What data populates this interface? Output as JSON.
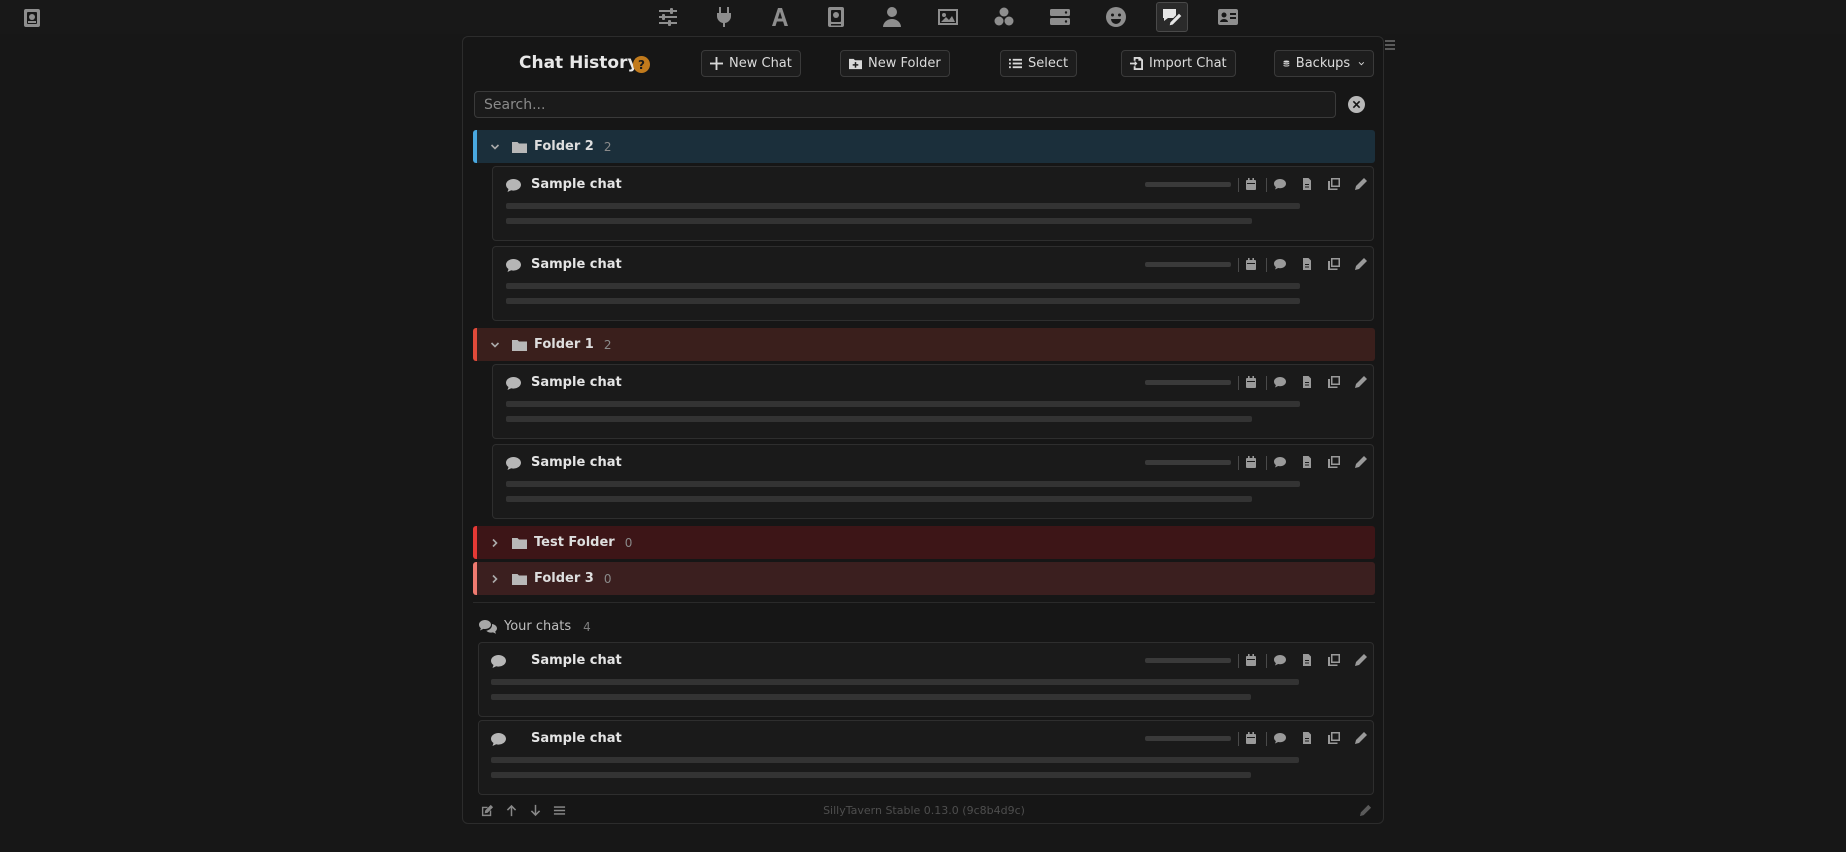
{
  "topbar": {
    "left_icon": "book-icon",
    "icons": [
      {
        "name": "sliders-icon",
        "active": false
      },
      {
        "name": "plug-icon",
        "active": false
      },
      {
        "name": "font-icon",
        "active": false
      },
      {
        "name": "book-atlas-icon",
        "active": false
      },
      {
        "name": "user-icon",
        "active": false
      },
      {
        "name": "image-icon",
        "active": false
      },
      {
        "name": "cubes-icon",
        "active": false
      },
      {
        "name": "server-icon",
        "active": false
      },
      {
        "name": "smile-icon",
        "active": false
      },
      {
        "name": "pen-chat-icon",
        "active": true
      },
      {
        "name": "id-card-icon",
        "active": false
      }
    ]
  },
  "header": {
    "title": "Chat History",
    "help_label": "?",
    "new_chat_label": "New Chat",
    "new_folder_label": "New Folder",
    "select_label": "Select",
    "import_label": "Import Chat",
    "backups_label": "Backups"
  },
  "search": {
    "placeholder": "Search..."
  },
  "folders": [
    {
      "name": "Folder 2",
      "count": "2",
      "expanded": true,
      "color": "#49a8e0",
      "bg": "#1b2f3b"
    },
    {
      "name": "Folder 1",
      "count": "2",
      "expanded": true,
      "color": "#e04a3a",
      "bg": "#3a1f1c"
    },
    {
      "name": "Test Folder",
      "count": "0",
      "expanded": false,
      "color": "#e53935",
      "bg": "#3d1517"
    },
    {
      "name": "Folder 3",
      "count": "0",
      "expanded": false,
      "color": "#ef7a70",
      "bg": "#3b1f1f"
    }
  ],
  "folder_chats": [
    {
      "name": "Sample chat"
    },
    {
      "name": "Sample chat"
    },
    {
      "name": "Sample chat"
    },
    {
      "name": "Sample chat"
    }
  ],
  "your_chats": {
    "label": "Your chats",
    "count": "4",
    "items": [
      {
        "name": "Sample chat"
      },
      {
        "name": "Sample chat"
      }
    ]
  },
  "footer": {
    "version": "SillyTavern Stable 0.13.0 (9c8b4d9c)"
  }
}
